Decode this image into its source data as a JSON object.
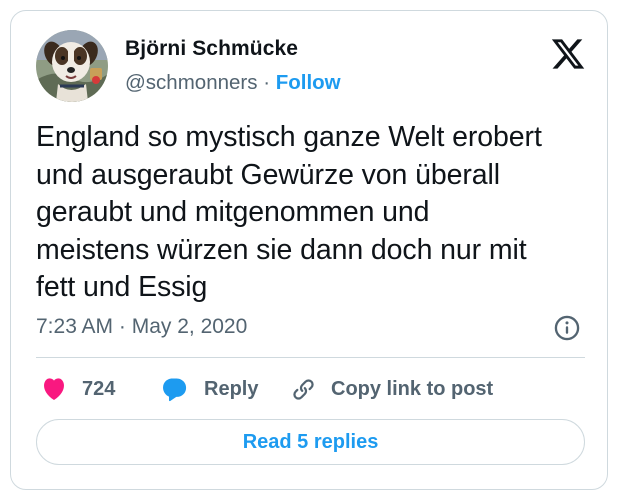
{
  "author": {
    "name": "Björni Schmücke",
    "handle": "@schmonners",
    "separator": "·",
    "follow_label": "Follow"
  },
  "tweet": {
    "text": "England so mystisch ganze Welt erobert\nund ausgeraubt Gewürze von überall\ngeraubt und mitgenommen und\nmeistens würzen sie dann doch nur mit\nfett und Essig",
    "timestamp": "7:23 AM · May 2, 2020"
  },
  "actions": {
    "like_count": "724",
    "reply_label": "Reply",
    "copy_link_label": "Copy link to post"
  },
  "replies_button": {
    "label": "Read 5 replies"
  },
  "icons": {
    "brand": "x-logo-icon",
    "info": "info-icon",
    "like": "heart-icon",
    "reply": "speech-bubble-icon",
    "copy_link": "link-icon"
  },
  "colors": {
    "accent": "#1d9bf0",
    "like": "#f91880",
    "text": "#0f1419",
    "secondary_text": "#536471",
    "border": "#cfd9de"
  }
}
